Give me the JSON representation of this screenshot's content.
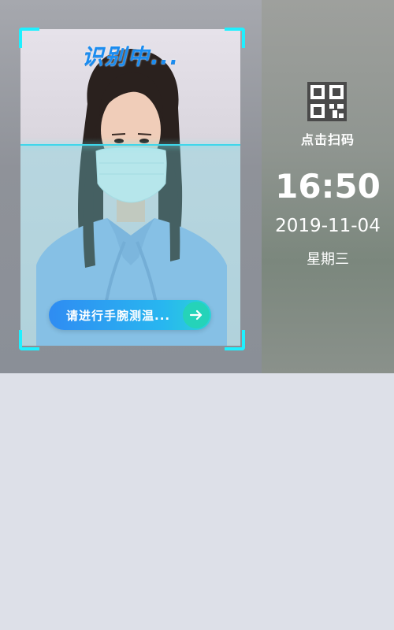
{
  "scanner": {
    "status_title": "识别中...",
    "prompt_text": "请进行手腕测温...",
    "arrow_icon": "arrow-right-icon",
    "accent_color": "#1ff0ff",
    "pill_color": "#2f8cf2",
    "arrow_color": "#25d3b9"
  },
  "info": {
    "qr_icon": "qr-code-icon",
    "qr_label": "点击扫码",
    "time": "16:50",
    "date": "2019-11-04",
    "weekday": "星期三"
  }
}
